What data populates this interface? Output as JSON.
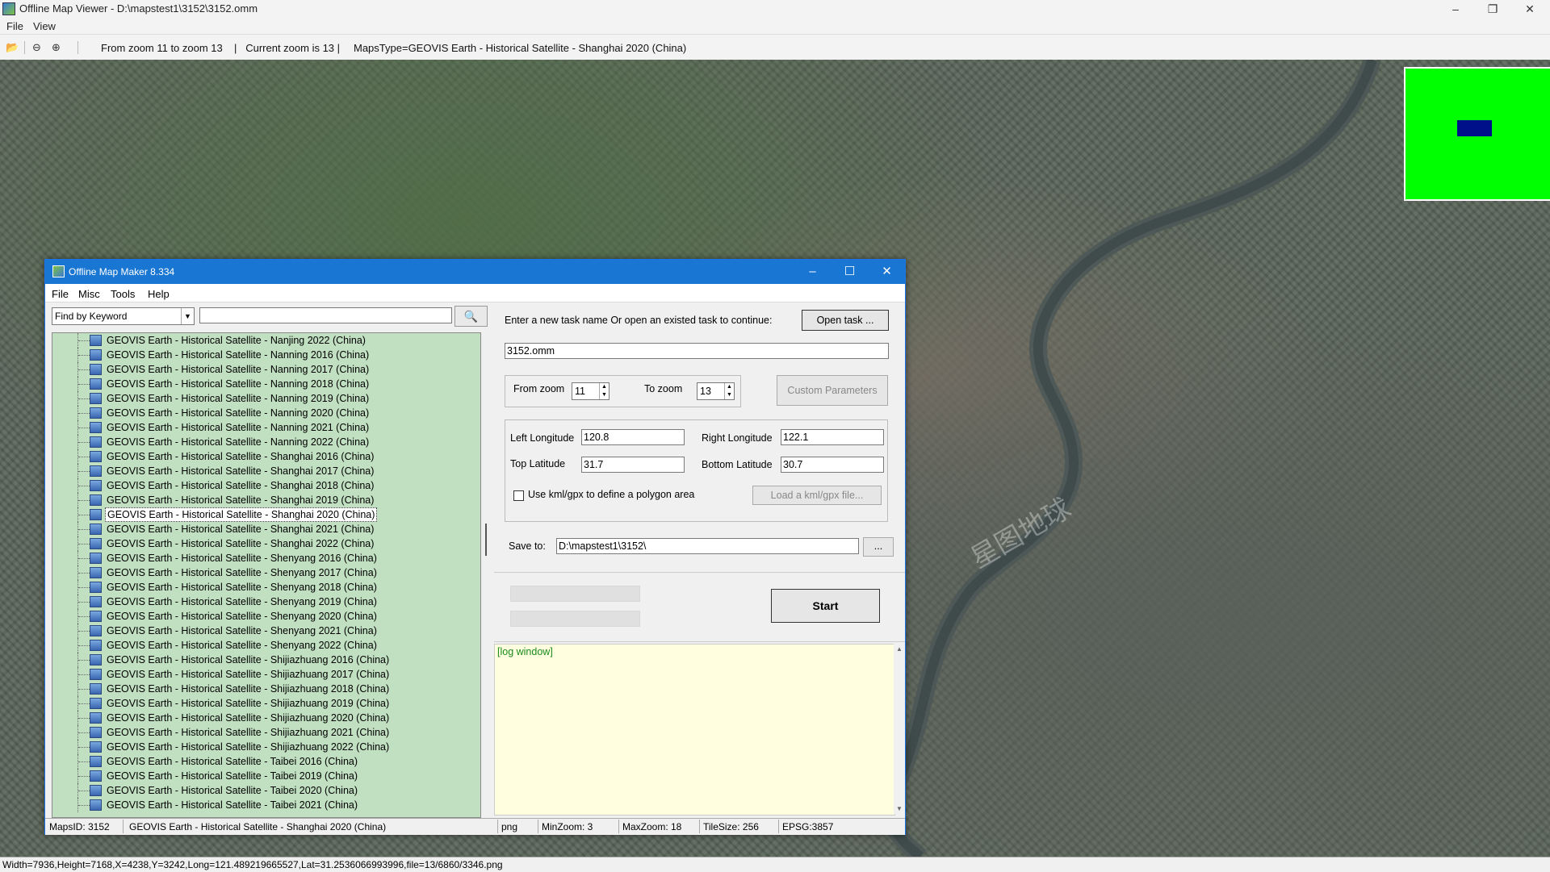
{
  "window": {
    "title": "Offline Map Viewer - D:\\mapstest1\\3152\\3152.omm",
    "controls": {
      "minimize": "–",
      "restore": "❐",
      "close": "✕"
    }
  },
  "menu": {
    "file": "File",
    "view": "View"
  },
  "toolbar": {
    "zoom_range": "From zoom 11 to zoom 13",
    "current_zoom": "|   Current zoom is 13 |",
    "maps_type": "MapsType=GEOVIS Earth - Historical Satellite - Shanghai 2020 (China)",
    "open_glyph": "📂",
    "zoom_out_glyph": "⊖",
    "zoom_in_glyph": "⊕"
  },
  "map": {
    "watermark": "星图地球",
    "minimap_color": "#00ff00",
    "viewport_color": "#00108a"
  },
  "status_bar": {
    "text": "Width=7936,Height=7168,X=4238,Y=3242,Long=121.489219665527,Lat=31.2536066993996,file=13/6860/3346.png"
  },
  "dialog": {
    "title": "Offline Map Maker 8.334",
    "menu": [
      "File",
      "Misc",
      "Tools",
      "Help"
    ],
    "search": {
      "mode": "Find by Keyword",
      "query": "",
      "button_glyph": "🔍"
    },
    "tree_items": [
      "GEOVIS Earth - Historical Satellite - Nanjing 2022 (China)",
      "GEOVIS Earth - Historical Satellite - Nanning 2016 (China)",
      "GEOVIS Earth - Historical Satellite - Nanning 2017 (China)",
      "GEOVIS Earth - Historical Satellite - Nanning 2018 (China)",
      "GEOVIS Earth - Historical Satellite - Nanning 2019 (China)",
      "GEOVIS Earth - Historical Satellite - Nanning 2020 (China)",
      "GEOVIS Earth - Historical Satellite - Nanning 2021 (China)",
      "GEOVIS Earth - Historical Satellite - Nanning 2022 (China)",
      "GEOVIS Earth - Historical Satellite - Shanghai 2016 (China)",
      "GEOVIS Earth - Historical Satellite - Shanghai 2017 (China)",
      "GEOVIS Earth - Historical Satellite - Shanghai 2018 (China)",
      "GEOVIS Earth - Historical Satellite - Shanghai 2019 (China)",
      "GEOVIS Earth - Historical Satellite - Shanghai 2020 (China)",
      "GEOVIS Earth - Historical Satellite - Shanghai 2021 (China)",
      "GEOVIS Earth - Historical Satellite - Shanghai 2022 (China)",
      "GEOVIS Earth - Historical Satellite - Shenyang 2016 (China)",
      "GEOVIS Earth - Historical Satellite - Shenyang 2017 (China)",
      "GEOVIS Earth - Historical Satellite - Shenyang 2018 (China)",
      "GEOVIS Earth - Historical Satellite - Shenyang 2019 (China)",
      "GEOVIS Earth - Historical Satellite - Shenyang 2020 (China)",
      "GEOVIS Earth - Historical Satellite - Shenyang 2021 (China)",
      "GEOVIS Earth - Historical Satellite - Shenyang 2022 (China)",
      "GEOVIS Earth - Historical Satellite - Shijiazhuang 2016 (China)",
      "GEOVIS Earth - Historical Satellite - Shijiazhuang 2017 (China)",
      "GEOVIS Earth - Historical Satellite - Shijiazhuang 2018 (China)",
      "GEOVIS Earth - Historical Satellite - Shijiazhuang 2019 (China)",
      "GEOVIS Earth - Historical Satellite - Shijiazhuang 2020 (China)",
      "GEOVIS Earth - Historical Satellite - Shijiazhuang 2021 (China)",
      "GEOVIS Earth - Historical Satellite - Shijiazhuang 2022 (China)",
      "GEOVIS Earth - Historical Satellite - Taibei 2016 (China)",
      "GEOVIS Earth - Historical Satellite - Taibei 2019 (China)",
      "GEOVIS Earth - Historical Satellite - Taibei 2020 (China)",
      "GEOVIS Earth - Historical Satellite - Taibei 2021 (China)"
    ],
    "selected_item": "GEOVIS Earth - Historical Satellite - Shanghai 2020 (China)",
    "task_prompt": "Enter a new task name Or open an existed task to continue:",
    "open_task_label": "Open task ...",
    "task_name": "3152.omm",
    "from_zoom_label": "From zoom",
    "from_zoom": "11",
    "to_zoom_label": "To zoom",
    "to_zoom": "13",
    "custom_params_label": "Custom Parameters",
    "left_longitude_label": "Left Longitude",
    "left_longitude": "120.8",
    "right_longitude_label": "Right Longitude",
    "right_longitude": "122.1",
    "top_latitude_label": "Top Latitude",
    "top_latitude": "31.7",
    "bottom_latitude_label": "Bottom Latitude",
    "bottom_latitude": "30.7",
    "kml_checkbox_label": "Use kml/gpx to define a polygon area",
    "kml_checked": false,
    "load_kml_label": "Load a kml/gpx file...",
    "save_to_label": "Save to:",
    "save_to": "D:\\mapstest1\\3152\\",
    "browse_label": "...",
    "start_label": "Start",
    "log_text": "[log window]",
    "status": {
      "maps_id": "MapsID: 3152",
      "maps_name": "GEOVIS Earth - Historical Satellite - Shanghai 2020 (China)",
      "format": "png",
      "min_zoom": "MinZoom: 3",
      "max_zoom": "MaxZoom: 18",
      "tile_size": "TileSize: 256",
      "epsg": "EPSG:3857"
    }
  }
}
